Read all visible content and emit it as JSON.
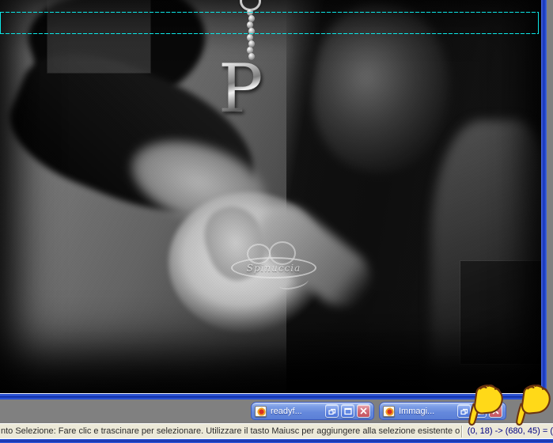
{
  "canvas": {
    "charm": {
      "letter": "P"
    },
    "watermark": {
      "text": "Spinuccia"
    },
    "selection": {
      "visible": true,
      "from": "(0, 18)",
      "to": "(680, 45)",
      "color": "#0ce6e6"
    }
  },
  "minimized_windows": [
    {
      "title": "readyf..."
    },
    {
      "title": "Immagi..."
    }
  ],
  "status_bar": {
    "message": "nto Selezione: Fare clic e trascinare per selezionare. Utilizzare il tasto Maiusc per aggiungere alla selezione esistente o C",
    "coordinates": "(0, 18) -> (680, 45) = ("
  },
  "icons": {
    "document": "psp-image-document",
    "restore": "two-overlapping-squares",
    "maximize": "square-outline",
    "close": "x-cross",
    "pointer": "yellow-hand-pointing-down"
  },
  "colors": {
    "workspace": "#808080",
    "window_border_blue": "#2a50d0",
    "titlebar_blue": "#6488dc",
    "close_red": "#c4545e",
    "statusbar_bg": "#ece9d8",
    "statusbar_coords_text": "#000080",
    "selection_cyan": "#0ce6e6",
    "pointer_yellow": "#ffd918"
  }
}
